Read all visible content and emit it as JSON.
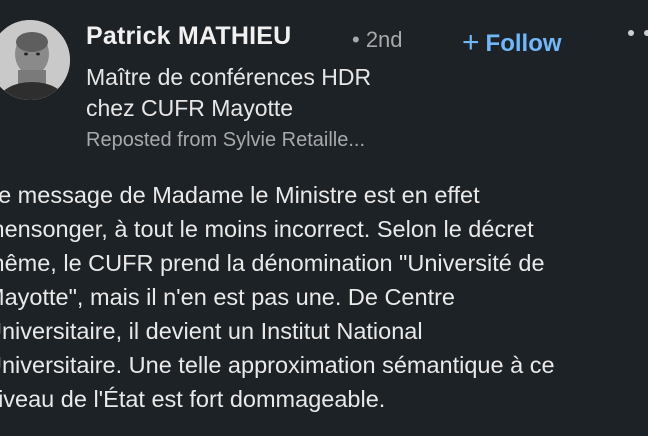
{
  "post": {
    "author_name": "Patrick MATHIEU",
    "connection_degree": "• 2nd",
    "follow_label": "Follow",
    "headline_lines": [
      "Maître de conférences HDR",
      "chez CUFR Mayotte"
    ],
    "repost_text": "Reposted from Sylvie Retaille...",
    "body_lines": [
      "Le message de Madame le Ministre est en effet",
      "mensonger, à tout le moins incorrect. Selon le décret",
      "même, le CUFR prend la dénomination \"Université de",
      "Mayotte\", mais il n'en est pas une. De Centre",
      "Universitaire, il devient un Institut National",
      "Universitaire. Une telle approximation sémantique à ce",
      "niveau de l'État est fort dommageable."
    ]
  },
  "icons": {
    "follow": "plus-icon",
    "more": "more-options-icon",
    "avatar": "profile-photo"
  },
  "colors": {
    "background": "#1d2226",
    "accent": "#71b7fb",
    "secondary_text": "#a7a9ab",
    "primary_text": "#e9e9e9"
  }
}
